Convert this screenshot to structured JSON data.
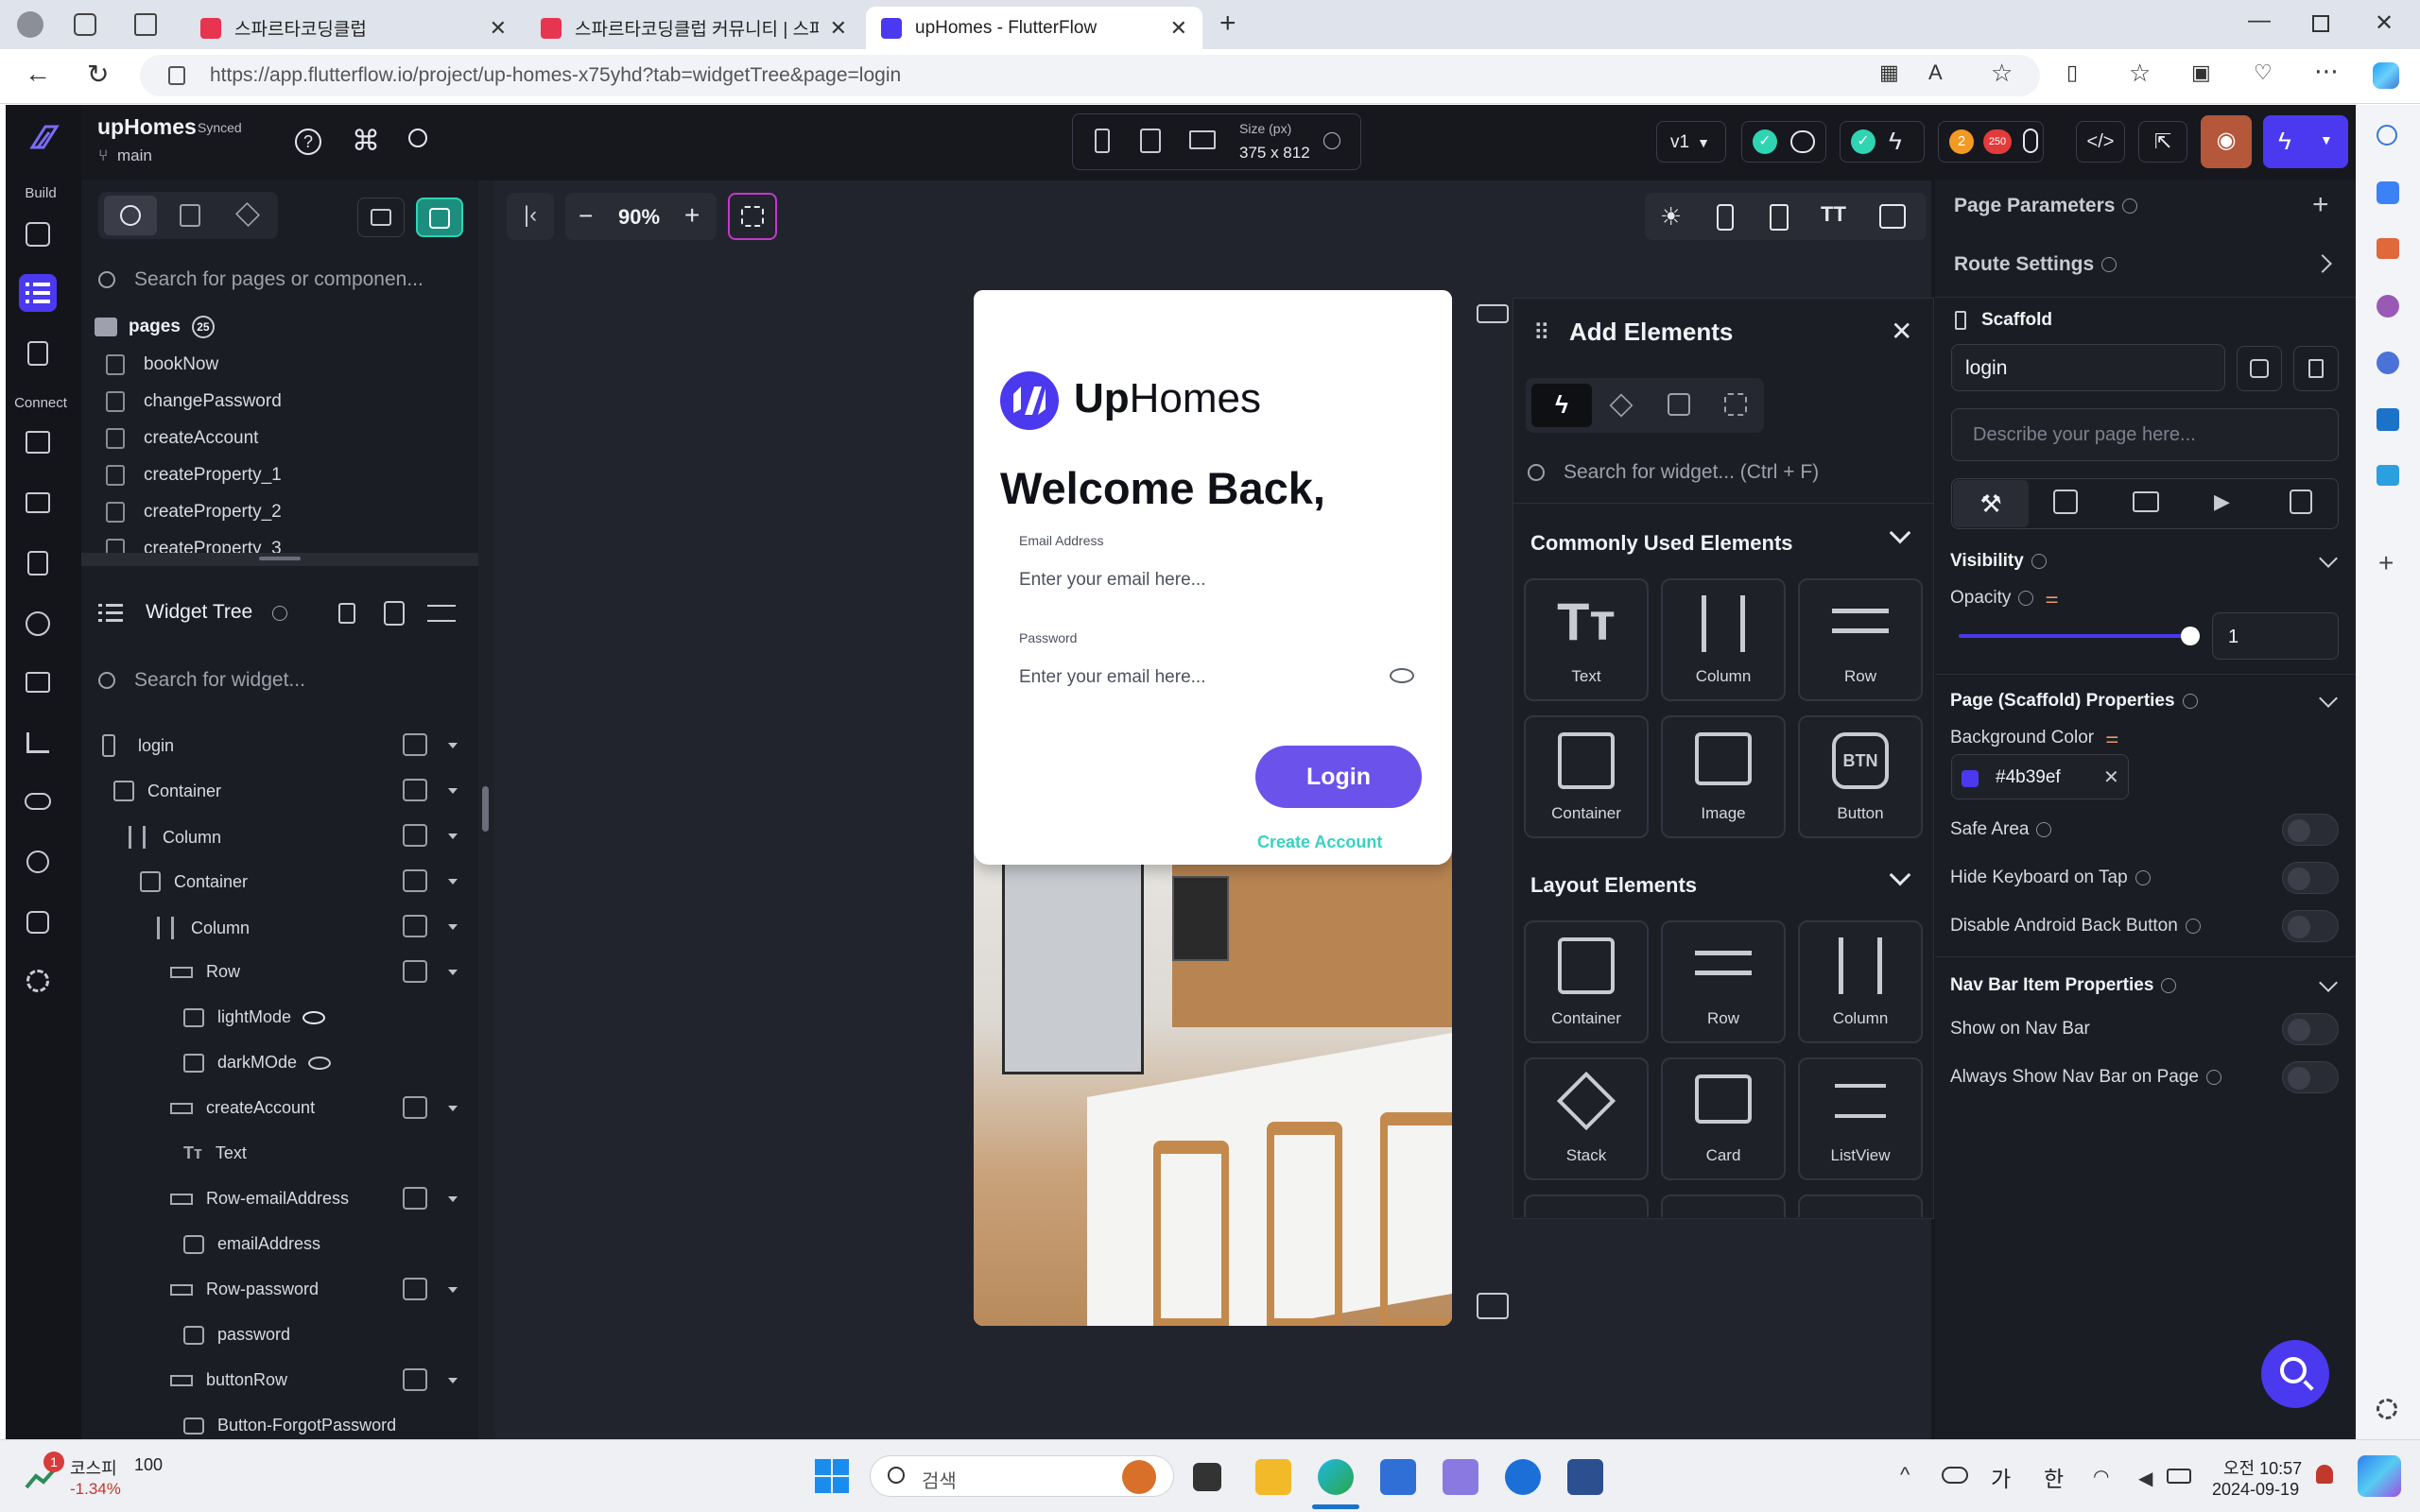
{
  "browser": {
    "tabs": [
      {
        "title": "스파르타코딩클럽",
        "active": false
      },
      {
        "title": "스파르타코딩클럽 커뮤니티 | 스파",
        "active": false
      },
      {
        "title": "upHomes - FlutterFlow",
        "active": true
      }
    ],
    "url": "https://app.flutterflow.io/project/up-homes-x75yhd?tab=widgetTree&page=login"
  },
  "app": {
    "project_name": "upHomes",
    "sync_status": "Synced",
    "branch": "main",
    "rail_labels": {
      "build": "Build",
      "connect": "Connect"
    },
    "size_label": "Size (px)",
    "size_value": "375 x 812",
    "version": "v1",
    "badge_warnings": "2",
    "badge_errors": "250",
    "zoom": "90%",
    "accent": "#4b39ef"
  },
  "left_panel": {
    "search_placeholder": "Search for pages or componen...",
    "pages_label": "pages",
    "pages_count": "25",
    "pages": [
      "bookNow",
      "changePassword",
      "createAccount",
      "createProperty_1",
      "createProperty_2",
      "createProperty_3"
    ],
    "widget_tree_title": "Widget Tree",
    "widget_search_placeholder": "Search for widget...",
    "tree": [
      {
        "label": "login",
        "type": "page"
      },
      {
        "label": "Container",
        "type": "container"
      },
      {
        "label": "Column",
        "type": "column"
      },
      {
        "label": "Container",
        "type": "container"
      },
      {
        "label": "Column",
        "type": "column"
      },
      {
        "label": "Row",
        "type": "row"
      },
      {
        "label": "lightMode",
        "type": "image"
      },
      {
        "label": "darkMOde",
        "type": "image"
      },
      {
        "label": "createAccount",
        "type": "row"
      },
      {
        "label": "Text",
        "type": "text"
      },
      {
        "label": "Row-emailAddress",
        "type": "row"
      },
      {
        "label": "emailAddress",
        "type": "field"
      },
      {
        "label": "Row-password",
        "type": "row"
      },
      {
        "label": "password",
        "type": "field"
      },
      {
        "label": "buttonRow",
        "type": "row"
      },
      {
        "label": "Button-ForgotPassword",
        "type": "button"
      }
    ]
  },
  "phone": {
    "logo_up": "Up",
    "logo_homes": "Homes",
    "welcome": "Welcome Back,",
    "email_label": "Email Address",
    "email_placeholder": "Enter your email here...",
    "password_label": "Password",
    "password_placeholder": "Enter your email here...",
    "login_button": "Login",
    "create_account": "Create Account",
    "button_color": "#4b39ef",
    "link_color": "#39d2c0"
  },
  "add_elements": {
    "title": "Add Elements",
    "search_placeholder": "Search for widget... (Ctrl + F)",
    "common_title": "Commonly Used Elements",
    "common": [
      "Text",
      "Column",
      "Row",
      "Container",
      "Image",
      "Button"
    ],
    "layout_title": "Layout Elements",
    "layout": [
      "Container",
      "Row",
      "Column",
      "Stack",
      "Card",
      "ListView"
    ],
    "btn_icon_text": "BTN"
  },
  "right_panel": {
    "page_params": "Page Parameters",
    "route_settings": "Route Settings",
    "scaffold": "Scaffold",
    "page_name": "login",
    "describe_placeholder": "Describe your page here...",
    "visibility": "Visibility",
    "opacity": "Opacity",
    "opacity_value": "1",
    "scaffold_props": "Page (Scaffold) Properties",
    "background_color_label": "Background Color",
    "background_color": "#4b39ef",
    "safe_area": "Safe Area",
    "hide_keyboard": "Hide Keyboard on Tap",
    "disable_back": "Disable Android Back Button",
    "nav_props": "Nav Bar Item Properties",
    "show_nav": "Show on Nav Bar",
    "always_show_nav": "Always Show Nav Bar on Page"
  },
  "taskbar": {
    "stock_name": "코스피",
    "stock_value": "100",
    "stock_change": "-1.34%",
    "notif_count": "1",
    "search_placeholder": "검색",
    "ime_1": "가",
    "ime_2": "한",
    "time": "오전 10:57",
    "date": "2024-09-19"
  }
}
